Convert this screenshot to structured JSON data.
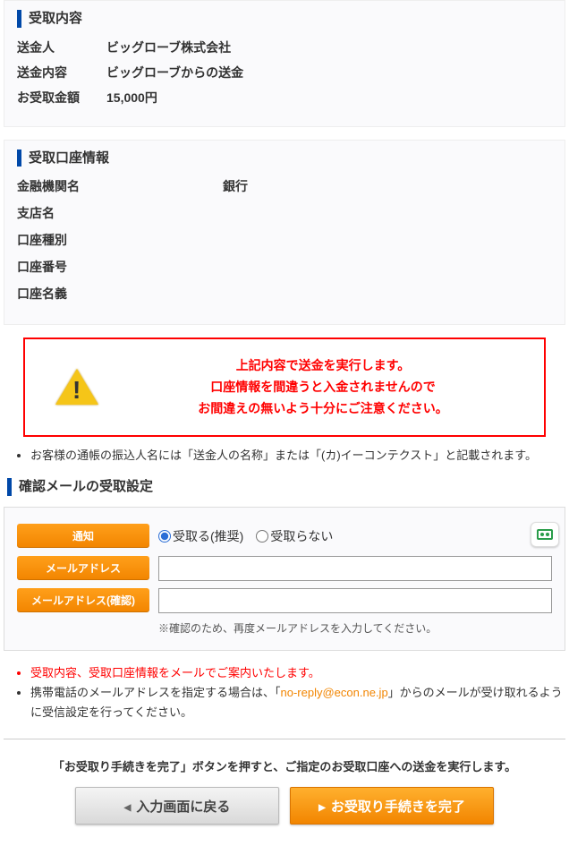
{
  "sections": {
    "receipt": {
      "header": "受取内容",
      "sender_label": "送金人",
      "sender_value": "ビッグローブ株式会社",
      "content_label": "送金内容",
      "content_value": "ビッグローブからの送金",
      "amount_label": "お受取金額",
      "amount_value": "15,000円"
    },
    "account": {
      "header": "受取口座情報",
      "bank_label": "金融機関名",
      "bank_value": "銀行",
      "branch_label": "支店名",
      "branch_value": "",
      "type_label": "口座種別",
      "type_value": "",
      "number_label": "口座番号",
      "number_value": "",
      "holder_label": "口座名義",
      "holder_value": ""
    }
  },
  "warning": {
    "line1": "上記内容で送金を実行します。",
    "line2": "口座情報を間違うと入金されませんので",
    "line3": "お間違えの無いよう十分にご注意ください。"
  },
  "note1": "お客様の通帳の振込人名には「送金人の名称」または「(カ)イーコンテクスト」と記載されます。",
  "mail": {
    "header": "確認メールの受取設定",
    "notify_label": "通知",
    "option_receive": "受取る(推奨)",
    "option_not": "受取らない",
    "addr_label": "メールアドレス",
    "addr_confirm_label": "メールアドレス(確認)",
    "confirm_note": "※確認のため、再度メールアドレスを入力してください。"
  },
  "notes2": {
    "a": "受取内容、受取口座情報をメールでご案内いたします。",
    "b_pre": "携帯電話のメールアドレスを指定する場合は、「",
    "b_link": "no-reply@econ.ne.jp",
    "b_post": "」からのメールが受け取れるように受信設定を行ってください。"
  },
  "bottom": {
    "instruction": "「お受取り手続きを完了」ボタンを押すと、ご指定のお受取口座への送金を実行します。",
    "back_btn": "入力画面に戻る",
    "submit_btn": "お受取り手続きを完了"
  }
}
